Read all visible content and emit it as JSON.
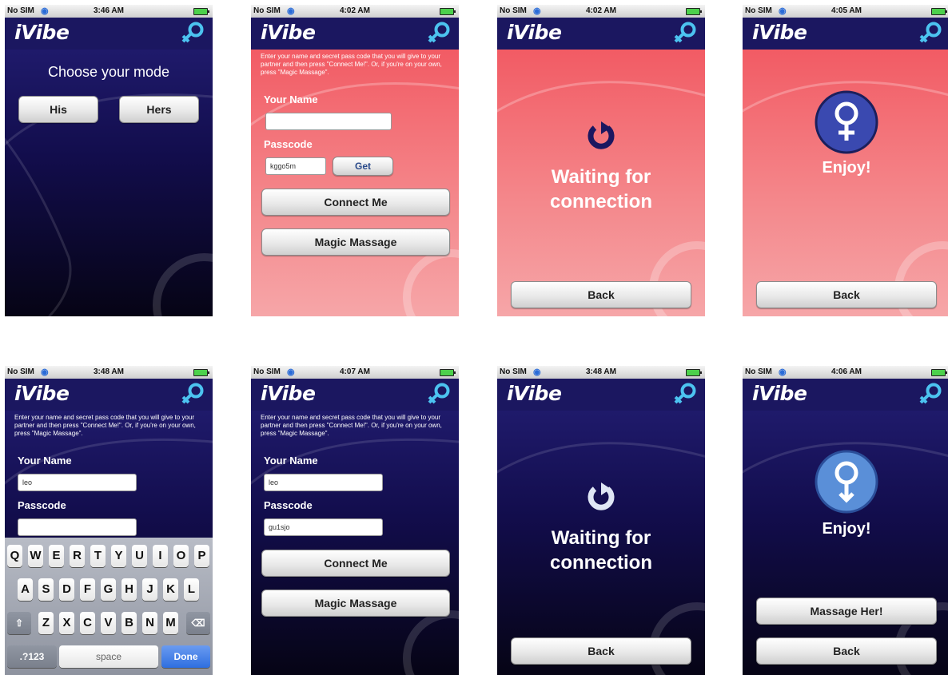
{
  "status": {
    "carrier": "No SIM",
    "times": [
      "3:46 AM",
      "4:02 AM",
      "4:02 AM",
      "4:05 AM",
      "3:48 AM",
      "4:07 AM",
      "3:48 AM",
      "4:06 AM"
    ]
  },
  "app": {
    "name": "iVibe"
  },
  "mode": {
    "title": "Choose your mode",
    "his": "His",
    "hers": "Hers"
  },
  "form": {
    "instructions": "Enter your name and secret pass code that you will give to your partner and then press \"Connect Me!\". Or, if you're on your own, press \"Magic Massage\".",
    "name_label": "Your Name",
    "passcode_label": "Passcode",
    "get_button": "Get",
    "connect_button": "Connect Me",
    "magic_button": "Magic Massage",
    "pink_passcode": "kggo5m",
    "kb_name": "leo",
    "kb_passcode": "",
    "dark_name": "leo",
    "dark_passcode": "gu1sjo"
  },
  "waiting": {
    "line1": "Waiting for",
    "line2": "connection",
    "back": "Back"
  },
  "enjoy": {
    "text": "Enjoy!",
    "massage_button": "Massage Her!",
    "back": "Back"
  },
  "keyboard": {
    "row1": [
      "Q",
      "W",
      "E",
      "R",
      "T",
      "Y",
      "U",
      "I",
      "O",
      "P"
    ],
    "row2": [
      "A",
      "S",
      "D",
      "F",
      "G",
      "H",
      "J",
      "K",
      "L"
    ],
    "row3": [
      "Z",
      "X",
      "C",
      "V",
      "B",
      "N",
      "M"
    ],
    "numbers": ".?123",
    "space": "space",
    "done": "Done"
  },
  "colors": {
    "header": "#1b1760",
    "pink": "#f25b64",
    "dark": "#120d4c",
    "accent": "#2f6fe0"
  },
  "icons": [
    "wifi-icon",
    "battery-icon",
    "female-symbol-icon",
    "refresh-icon",
    "shift-icon",
    "backspace-icon"
  ]
}
